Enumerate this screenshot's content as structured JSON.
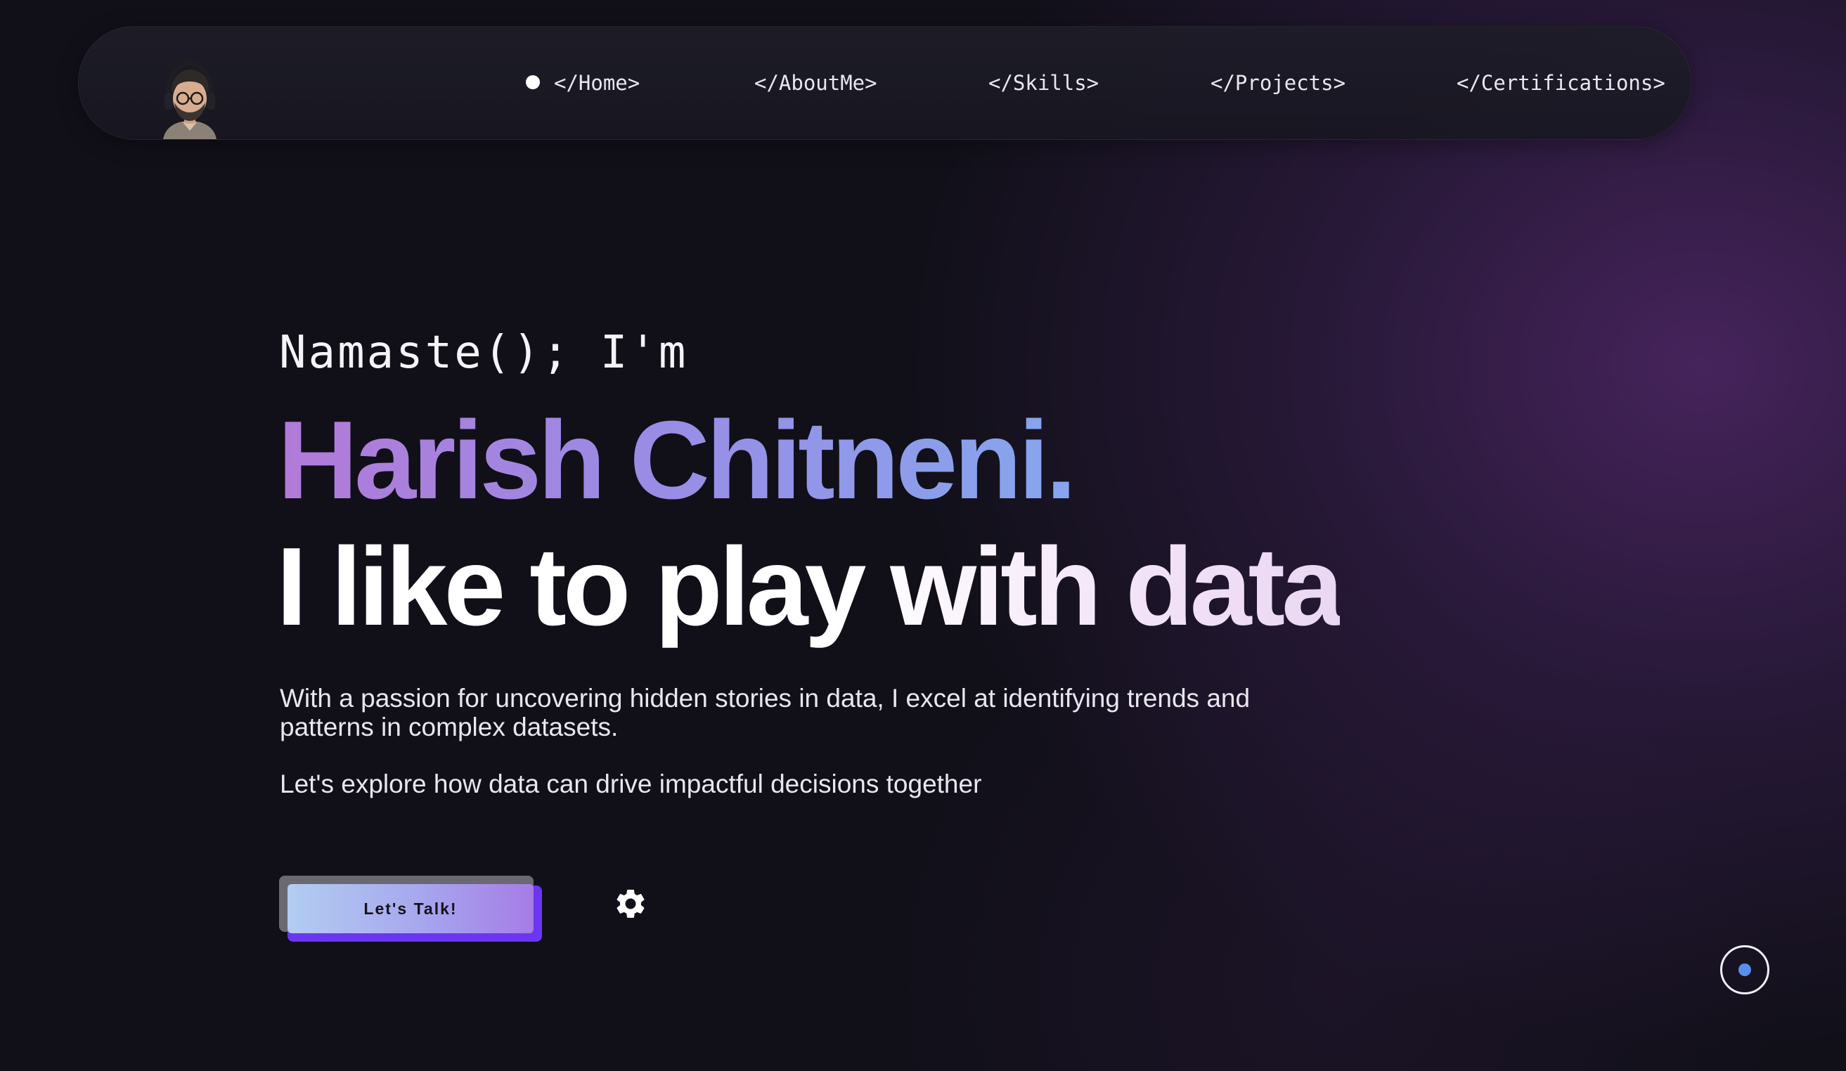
{
  "nav": {
    "items": [
      {
        "label": "</Home>",
        "active": true
      },
      {
        "label": "</AboutMe>",
        "active": false
      },
      {
        "label": "</Skills>",
        "active": false
      },
      {
        "label": "</Projects>",
        "active": false
      },
      {
        "label": "</Certifications>",
        "active": false
      }
    ],
    "avatar_icon": "cartoon-avatar-with-headphones"
  },
  "hero": {
    "greeting": "Namaste(); I'm",
    "name": "Harish Chitneni.",
    "tagline": "I like to play with data",
    "description": "With a passion for uncovering hidden stories in data, I excel at identifying trends and patterns in complex datasets.",
    "description2": "Let's explore how data can drive impactful decisions together",
    "cta_label": "Let's Talk!",
    "settings_icon": "gear-icon",
    "scroll_icon": "scroll-indicator-icon"
  },
  "colors": {
    "background": "#111019",
    "glow": "#4e2a66",
    "name_gradient_start": "#b27ad8",
    "name_gradient_end": "#86a6ee",
    "cta_shadow": "#6b36f0",
    "scroll_dot": "#5a8df0"
  }
}
